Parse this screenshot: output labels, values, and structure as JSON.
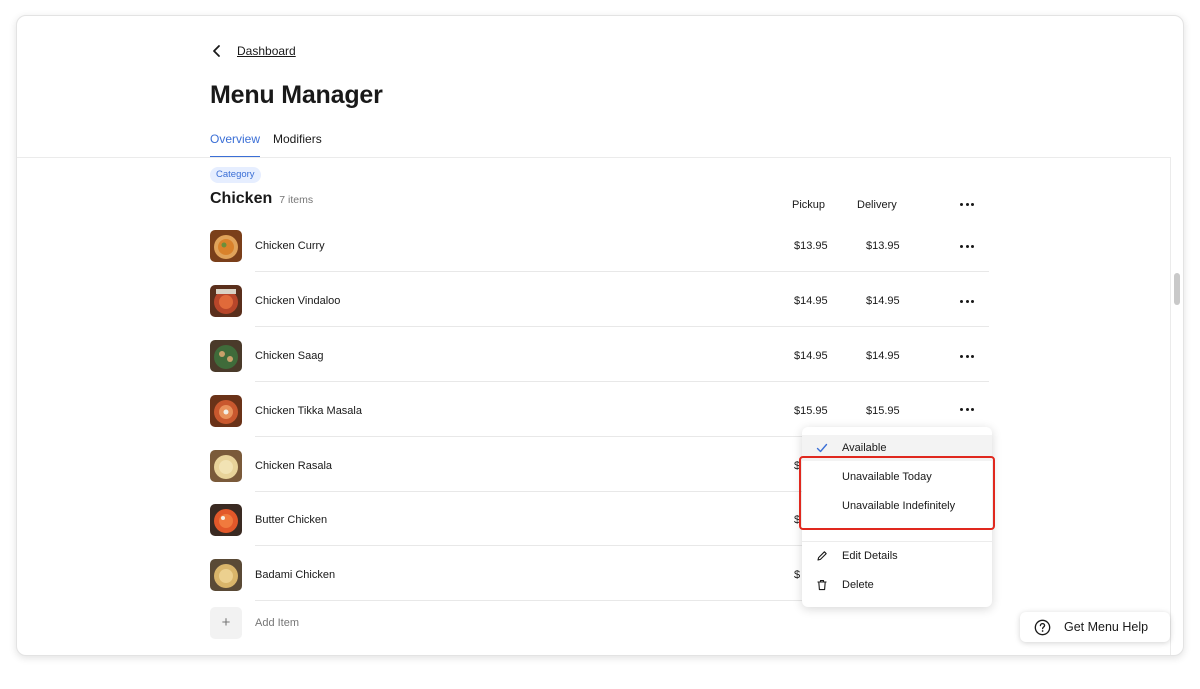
{
  "nav": {
    "back_label": "Dashboard"
  },
  "page": {
    "title": "Menu Manager"
  },
  "tabs": [
    {
      "label": "Overview",
      "active": true
    },
    {
      "label": "Modifiers",
      "active": false
    }
  ],
  "category": {
    "pill": "Category",
    "name": "Chicken",
    "count": "7 items",
    "columns": {
      "pickup": "Pickup",
      "delivery": "Delivery"
    }
  },
  "items": [
    {
      "name": "Chicken Curry",
      "pickup": "$13.95",
      "delivery": "$13.95"
    },
    {
      "name": "Chicken Vindaloo",
      "pickup": "$14.95",
      "delivery": "$14.95"
    },
    {
      "name": "Chicken Saag",
      "pickup": "$14.95",
      "delivery": "$14.95"
    },
    {
      "name": "Chicken Tikka Masala",
      "pickup": "$15.95",
      "delivery": "$15.95"
    },
    {
      "name": "Chicken Rasala",
      "pickup": "$",
      "delivery": ""
    },
    {
      "name": "Butter Chicken",
      "pickup": "$",
      "delivery": ""
    },
    {
      "name": "Badami Chicken",
      "pickup": "$",
      "delivery": ""
    }
  ],
  "add_item": {
    "label": "Add Item"
  },
  "context_menu": {
    "available": "Available",
    "unavailable_today": "Unavailable Today",
    "unavailable_indefinitely": "Unavailable Indefinitely",
    "edit_details": "Edit Details",
    "delete": "Delete"
  },
  "help": {
    "label": "Get Menu Help"
  },
  "colors": {
    "accent": "#3b6fd6",
    "highlight": "#e0281e",
    "pill_bg": "#e6eeff"
  }
}
